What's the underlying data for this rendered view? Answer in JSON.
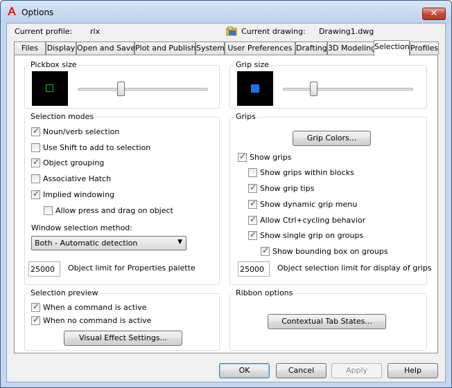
{
  "window": {
    "title": "Options",
    "close_label": "✕"
  },
  "header": {
    "current_profile_label": "Current profile:",
    "current_profile_value": "rlx",
    "current_drawing_label": "Current drawing:",
    "current_drawing_value": "Drawing1.dwg"
  },
  "tabs": [
    "Files",
    "Display",
    "Open and Save",
    "Plot and Publish",
    "System",
    "User Preferences",
    "Drafting",
    "3D Modeling",
    "Selection",
    "Profiles"
  ],
  "active_tab": "Selection",
  "pickbox": {
    "title": "Pickbox size",
    "level": 0.32
  },
  "grip_size": {
    "title": "Grip size",
    "level": 0.22
  },
  "selection_modes": {
    "title": "Selection modes",
    "items": [
      {
        "label": "Noun/verb selection",
        "checked": true
      },
      {
        "label": "Use Shift to add to selection",
        "checked": false
      },
      {
        "label": "Object grouping",
        "checked": true
      },
      {
        "label": "Associative Hatch",
        "checked": false
      },
      {
        "label": "Implied windowing",
        "checked": true
      },
      {
        "label": "Allow press and drag on object",
        "checked": false
      }
    ],
    "window_method_label": "Window selection method:",
    "window_method_value": "Both - Automatic detection",
    "object_limit_value": "25000",
    "object_limit_label": "Object limit for Properties palette"
  },
  "grips": {
    "title": "Grips",
    "grip_colors_button": "Grip Colors...",
    "items": [
      {
        "label": "Show grips",
        "checked": true
      },
      {
        "label": "Show grips within blocks",
        "checked": false
      },
      {
        "label": "Show grip tips",
        "checked": true
      },
      {
        "label": "Show dynamic grip menu",
        "checked": true
      },
      {
        "label": "Allow Ctrl+cycling behavior",
        "checked": true
      },
      {
        "label": "Show single grip on groups",
        "checked": true
      },
      {
        "label": "Show bounding box on groups",
        "checked": true
      }
    ],
    "limit_value": "25000",
    "limit_label": "Object selection limit for display of grips"
  },
  "selection_preview": {
    "title": "Selection preview",
    "items": [
      {
        "label": "When a command is active",
        "checked": true
      },
      {
        "label": "When no command is active",
        "checked": true
      }
    ],
    "visual_effect_button": "Visual Effect Settings..."
  },
  "ribbon": {
    "title": "Ribbon options",
    "contextual_button": "Contextual Tab States..."
  },
  "footer": {
    "ok": "OK",
    "cancel": "Cancel",
    "apply": "Apply",
    "help": "Help"
  },
  "colors": {
    "pickbox_square": "#00cc00",
    "grip_square": "#1e6ff0",
    "preview_bg": "#000000"
  }
}
